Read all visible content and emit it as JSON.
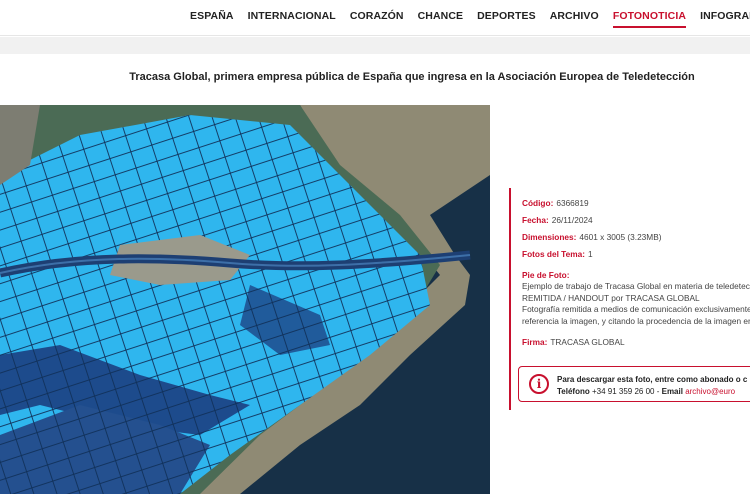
{
  "nav": {
    "items": [
      "ESPAÑA",
      "INTERNACIONAL",
      "CORAZÓN",
      "CHANCE",
      "DEPORTES",
      "ARCHIVO",
      "FOTONOTICIA",
      "INFOGRAFÍAS"
    ],
    "active": "FOTONOTICIA"
  },
  "article": {
    "title": "Tracasa Global, primera empresa pública de España que ingresa en la Asociación Europea de Teledetección"
  },
  "photo": {
    "alt": ""
  },
  "metadata": {
    "codigo_label": "Código:",
    "codigo": "6366819",
    "fecha_label": "Fecha:",
    "fecha": "26/11/2024",
    "dimensiones_label": "Dimensiones:",
    "dimensiones": "4601 x 3005 (3.23MB)",
    "fotos_label": "Fotos del Tema:",
    "fotos": "1",
    "pie_label": "Pie de Foto:",
    "pie_lines": [
      "Ejemplo de trabajo de Tracasa Global en materia de teledetecc",
      "REMITIDA / HANDOUT por TRACASA GLOBAL",
      "Fotografía remitida a medios de comunicación exclusivamente",
      "referencia la imagen, y citando la procedencia de la imagen en"
    ],
    "firma_label": "Firma:",
    "firma": "TRACASA GLOBAL"
  },
  "download": {
    "icon": "info-icon",
    "line1": "Para descargar esta foto, entre como abonado o c",
    "phone_label": "Teléfono",
    "phone": "+34 91 359 26 00",
    "email_label": "Email",
    "email": "archivo@euro"
  },
  "colors": {
    "accent": "#c8102e",
    "water_flood": "#2fb6ee",
    "sea_dark": "#173047"
  }
}
